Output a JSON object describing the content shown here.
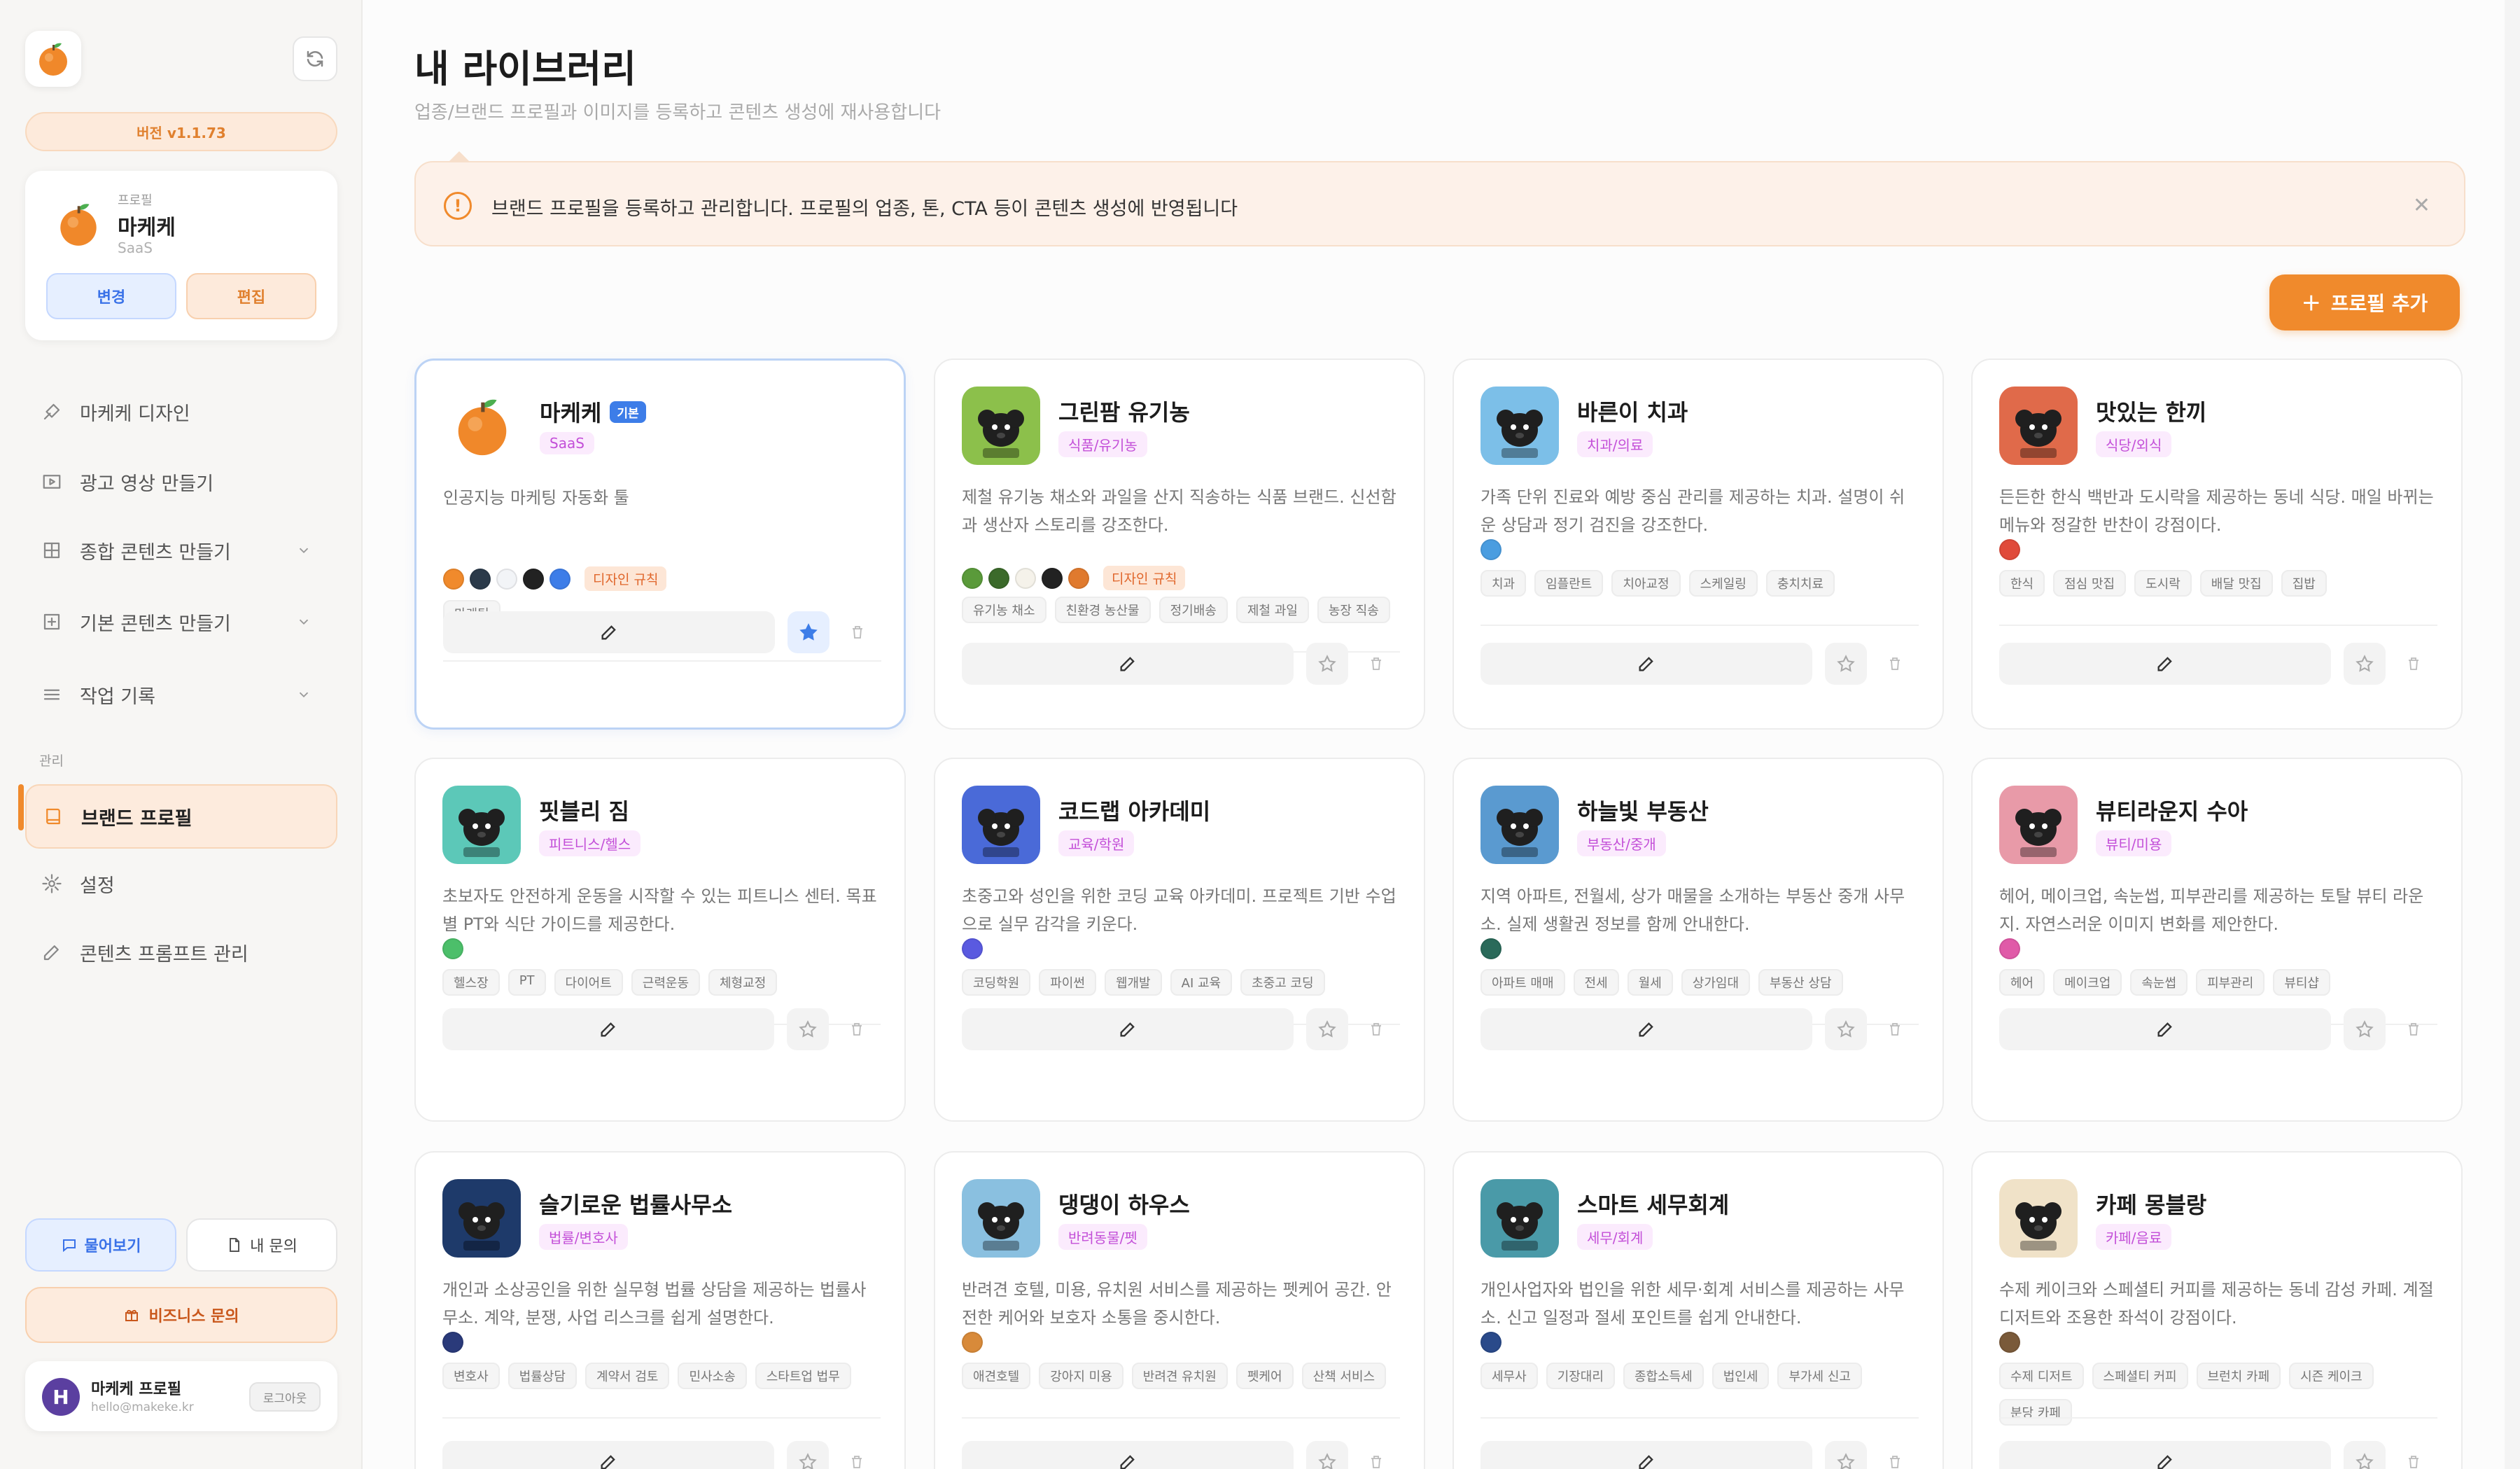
{
  "sidebar": {
    "version": "버전 v1.1.73",
    "profile": {
      "kicker": "프로필",
      "name": "마케케",
      "sub": "SaaS",
      "change": "변경",
      "edit": "편집"
    },
    "nav": [
      {
        "label": "마케케 디자인",
        "icon": "brush-icon"
      },
      {
        "label": "광고 영상 만들기",
        "icon": "video-icon"
      },
      {
        "label": "종합 콘텐츠 만들기",
        "icon": "grid-icon"
      },
      {
        "label": "기본 콘텐츠 만들기",
        "icon": "plus-square-icon"
      },
      {
        "label": "작업 기록",
        "icon": "list-icon"
      }
    ],
    "section": "관리",
    "manage": [
      {
        "label": "브랜드 프로필",
        "icon": "book-icon"
      },
      {
        "label": "설정",
        "icon": "gear-icon"
      },
      {
        "label": "콘텐츠 프롬프트 관리",
        "icon": "pen-icon"
      }
    ],
    "ask": "물어보기",
    "mine": "내 문의",
    "biz": "비즈니스 문의",
    "user": {
      "initial": "H",
      "name": "마케케 프로필",
      "email": "hello@makeke.kr",
      "logout": "로그아웃"
    }
  },
  "main": {
    "title": "내 라이브러리",
    "subtitle": "업종/브랜드 프로필과 이미지를 등록하고 콘텐츠 생성에 재사용합니다",
    "notice": "브랜드 프로필을 등록하고 관리합니다. 프로필의 업종, 톤, CTA 등이 콘텐츠 생성에 반영됩니다",
    "add": "프로필 추가"
  },
  "colors": {
    "accent": "#f08a2c",
    "blue": "#3d7de8"
  },
  "cards": [
    {
      "name": "마케케",
      "badge": "기본",
      "cat": "SaaS",
      "desc": "인공지능 마케팅 자동화 툴",
      "swatches": [
        "#f08a2c",
        "#2b3a4a",
        "#f2f4f7",
        "#222222",
        "#3d7de8"
      ],
      "rule": "디자인 규칙",
      "tags": [
        "마케팅"
      ],
      "icon": "orange",
      "bg": "#ffffff",
      "starred": true
    },
    {
      "name": "그린팜 유기농",
      "cat": "식품/유기농",
      "desc": "제철 유기농 채소와 과일을 산지 직송하는 식품 브랜드. 신선함과 생산자 스토리를 강조한다.",
      "swatches": [
        "#5a9a3a",
        "#3b6a2a",
        "#f5f2ea",
        "#222222",
        "#e07a2e"
      ],
      "rule": "디자인 규칙",
      "tags": [
        "유기농 채소",
        "친환경 농산물",
        "정기배송",
        "제철 과일",
        "농장 직송"
      ],
      "icon": "dog",
      "bg": "#8cc04b",
      "starred": false
    },
    {
      "name": "바른이 치과",
      "cat": "치과/의료",
      "desc": "가족 단위 진료와 예방 중심 관리를 제공하는 치과. 설명이 쉬운 상담과 정기 검진을 강조한다.",
      "swatches": [
        "#4a9de0"
      ],
      "tags": [
        "치과",
        "임플란트",
        "치아교정",
        "스케일링",
        "충치치료"
      ],
      "icon": "dog",
      "bg": "#7cbfe8",
      "starred": false
    },
    {
      "name": "맛있는 한끼",
      "cat": "식당/외식",
      "desc": "든든한 한식 백반과 도시락을 제공하는 동네 식당. 매일 바뀌는 메뉴와 정갈한 반찬이 강점이다.",
      "swatches": [
        "#e04a3a"
      ],
      "tags": [
        "한식",
        "점심 맛집",
        "도시락",
        "배달 맛집",
        "집밥"
      ],
      "icon": "dog",
      "bg": "#e06a4a",
      "starred": false
    },
    {
      "name": "핏블리 짐",
      "cat": "피트니스/헬스",
      "desc": "초보자도 안전하게 운동을 시작할 수 있는 피트니스 센터. 목표별 PT와 식단 가이드를 제공한다.",
      "swatches": [
        "#4cbf6a"
      ],
      "tags": [
        "헬스장",
        "PT",
        "다이어트",
        "근력운동",
        "체형교정"
      ],
      "icon": "dog",
      "bg": "#5cc8b8",
      "starred": false
    },
    {
      "name": "코드랩 아카데미",
      "cat": "교육/학원",
      "desc": "초중고와 성인을 위한 코딩 교육 아카데미. 프로젝트 기반 수업으로 실무 감각을 키운다.",
      "swatches": [
        "#5a5ae0"
      ],
      "tags": [
        "코딩학원",
        "파이썬",
        "웹개발",
        "AI 교육",
        "초중고 코딩"
      ],
      "icon": "dog",
      "bg": "#4a6ad8",
      "starred": false
    },
    {
      "name": "하늘빛 부동산",
      "cat": "부동산/중개",
      "desc": "지역 아파트, 전월세, 상가 매물을 소개하는 부동산 중개 사무소. 실제 생활권 정보를 함께 안내한다.",
      "swatches": [
        "#2a6a5a"
      ],
      "tags": [
        "아파트 매매",
        "전세",
        "월세",
        "상가임대",
        "부동산 상담"
      ],
      "icon": "dog",
      "bg": "#5a9ad0",
      "starred": false
    },
    {
      "name": "뷰티라운지 수아",
      "cat": "뷰티/미용",
      "desc": "헤어, 메이크업, 속눈썹, 피부관리를 제공하는 토탈 뷰티 라운지. 자연스러운 이미지 변화를 제안한다.",
      "swatches": [
        "#e05aa8"
      ],
      "tags": [
        "헤어",
        "메이크업",
        "속눈썹",
        "피부관리",
        "뷰티샵"
      ],
      "icon": "dog",
      "bg": "#e89aa8",
      "starred": false
    },
    {
      "name": "슬기로운 법률사무소",
      "cat": "법률/변호사",
      "desc": "개인과 소상공인을 위한 실무형 법률 상담을 제공하는 법률사무소. 계약, 분쟁, 사업 리스크를 쉽게 설명한다.",
      "swatches": [
        "#2a3a7a"
      ],
      "tags": [
        "변호사",
        "법률상담",
        "계약서 검토",
        "민사소송",
        "스타트업 법무"
      ],
      "icon": "dog",
      "bg": "#1e3a6a",
      "starred": false
    },
    {
      "name": "댕댕이 하우스",
      "cat": "반려동물/펫",
      "desc": "반려견 호텔, 미용, 유치원 서비스를 제공하는 펫케어 공간. 안전한 케어와 보호자 소통을 중시한다.",
      "swatches": [
        "#d88a3a"
      ],
      "tags": [
        "애견호텔",
        "강아지 미용",
        "반려견 유치원",
        "펫케어",
        "산책 서비스"
      ],
      "icon": "dog",
      "bg": "#8ac0e0",
      "starred": false
    },
    {
      "name": "스마트 세무회계",
      "cat": "세무/회계",
      "desc": "개인사업자와 법인을 위한 세무·회계 서비스를 제공하는 사무소. 신고 일정과 절세 포인트를 쉽게 안내한다.",
      "swatches": [
        "#2a4a8a"
      ],
      "tags": [
        "세무사",
        "기장대리",
        "종합소득세",
        "법인세",
        "부가세 신고"
      ],
      "icon": "dog",
      "bg": "#4a9aa8",
      "starred": false
    },
    {
      "name": "카페 몽블랑",
      "cat": "카페/음료",
      "desc": "수제 케이크와 스페셜티 커피를 제공하는 동네 감성 카페. 계절 디저트와 조용한 좌석이 강점이다.",
      "swatches": [
        "#7a5a3a"
      ],
      "tags": [
        "수제 디저트",
        "스페셜티 커피",
        "브런치 카페",
        "시즌 케이크",
        "분당 카페"
      ],
      "icon": "dog",
      "bg": "#f0e2c8",
      "starred": false
    }
  ]
}
